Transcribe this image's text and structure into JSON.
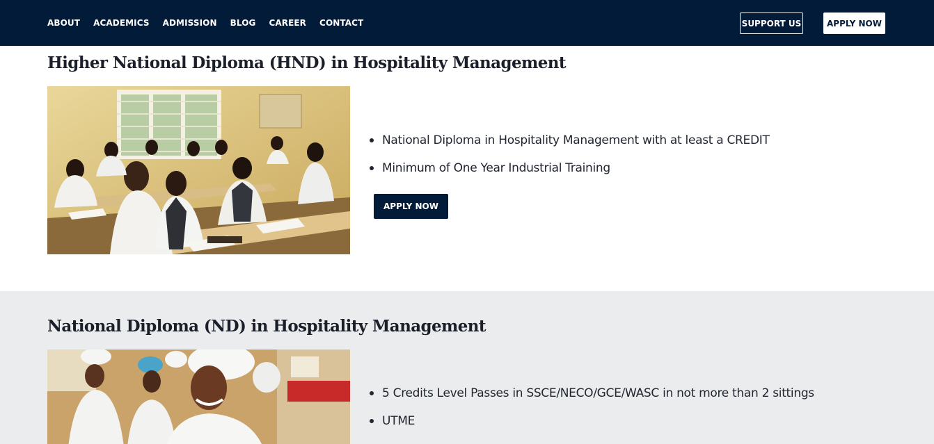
{
  "nav": {
    "links": [
      "ABOUT",
      "ACADEMICS",
      "ADMISSION",
      "BLOG",
      "CAREER",
      "CONTACT"
    ],
    "support_label": "SUPPORT US",
    "apply_label": "APPLY NOW"
  },
  "programs": [
    {
      "title": "Higher National Diploma (HND) in Hospitality Management",
      "image_icon": "classroom-photo",
      "requirements": [
        "National Diploma in Hospitality Management with at least a CREDIT",
        "Minimum of One Year Industrial Training"
      ],
      "apply_label": "APPLY NOW"
    },
    {
      "title": "National Diploma (ND) in Hospitality Management",
      "image_icon": "culinary-students-photo",
      "requirements": [
        "5 Credits Level Passes in SSCE/NECO/GCE/WASC in not more than 2 sittings",
        "UTME"
      ]
    }
  ],
  "colors": {
    "navy": "#021b38",
    "section_alt_bg": "#ebecee",
    "text": "#222631"
  }
}
